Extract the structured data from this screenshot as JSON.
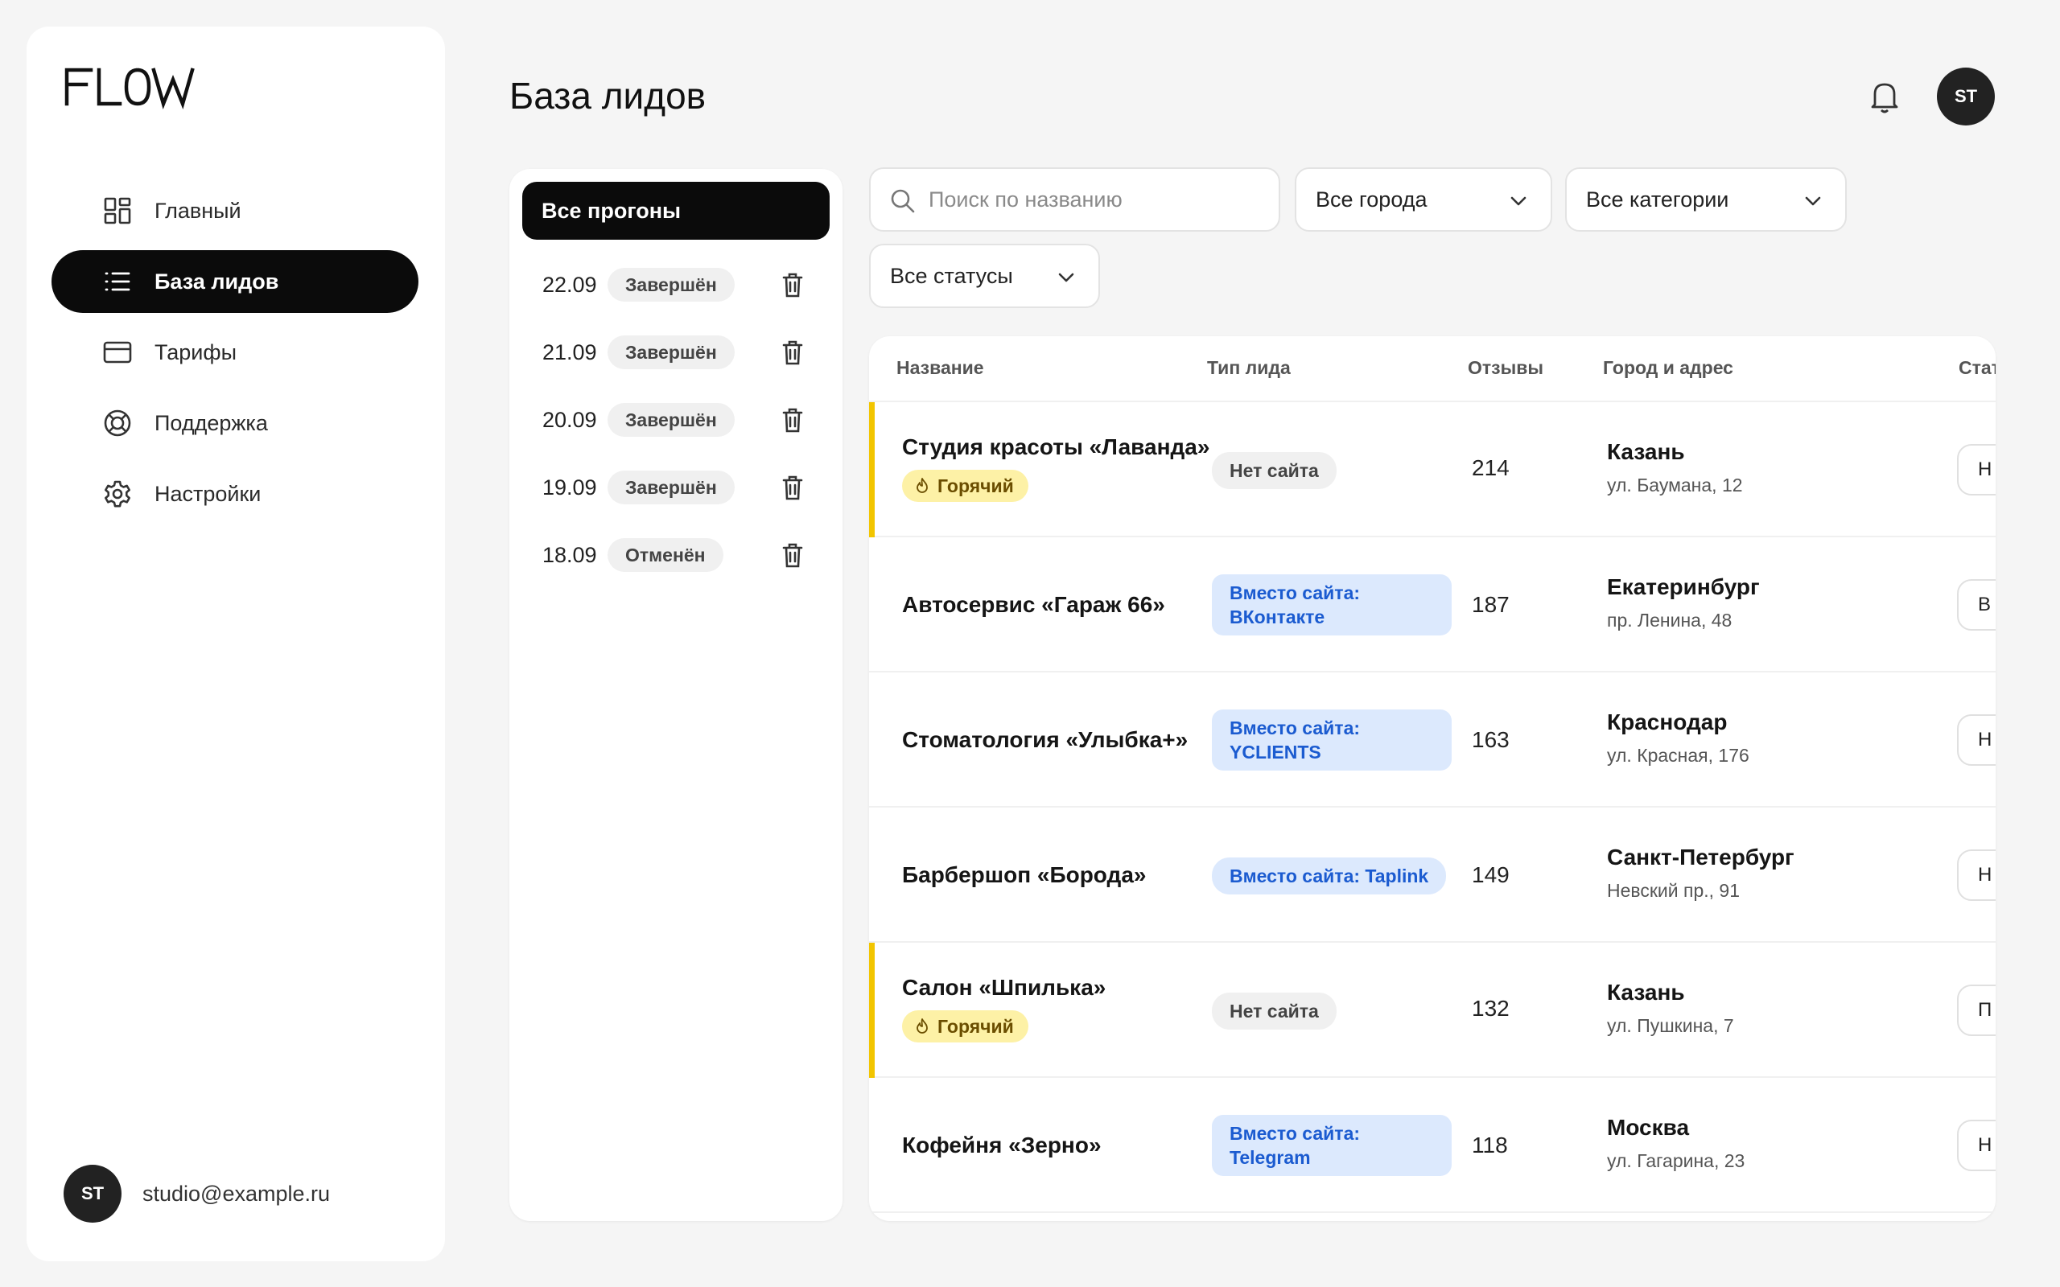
{
  "brand": {
    "logo_text": "FLOW"
  },
  "sidebar": {
    "items": [
      {
        "label": "Главный",
        "icon": "dashboard-grid-icon",
        "active": false
      },
      {
        "label": "База лидов",
        "icon": "list-icon",
        "active": true
      },
      {
        "label": "Тарифы",
        "icon": "credit-card-icon",
        "active": false
      },
      {
        "label": "Поддержка",
        "icon": "lifebuoy-icon",
        "active": false
      },
      {
        "label": "Настройки",
        "icon": "gear-icon",
        "active": false
      }
    ],
    "user": {
      "initials": "ST",
      "email": "studio@example.ru"
    }
  },
  "header": {
    "title": "База лидов",
    "avatar_initials": "ST",
    "bell_icon": "bell-icon"
  },
  "runs": {
    "all_label": "Все прогоны",
    "items": [
      {
        "date": "22.09",
        "status": "Завершён"
      },
      {
        "date": "21.09",
        "status": "Завершён"
      },
      {
        "date": "20.09",
        "status": "Завершён"
      },
      {
        "date": "19.09",
        "status": "Завершён"
      },
      {
        "date": "18.09",
        "status": "Отменён"
      }
    ]
  },
  "filters": {
    "search_placeholder": "Поиск по названию",
    "city": "Все города",
    "category": "Все категории",
    "status": "Все статусы"
  },
  "table": {
    "columns": [
      "Название",
      "Тип лида",
      "Отзывы",
      "Город и адрес",
      "Стат"
    ],
    "hot_label": "Горячий",
    "rows": [
      {
        "name": "Студия красоты «Лаванда»",
        "hot": true,
        "type": "Нет сайта",
        "type_kind": "nosite",
        "reviews": "214",
        "city": "Казань",
        "address": "ул. Баумана, 12",
        "status": "Н"
      },
      {
        "name": "Автосервис «Гараж 66»",
        "hot": false,
        "type": "Вместо сайта: ВКонтакте",
        "type_kind": "instead",
        "reviews": "187",
        "city": "Екатеринбург",
        "address": "пр. Ленина, 48",
        "status": "В"
      },
      {
        "name": "Стоматология «Улыбка+»",
        "hot": false,
        "type": "Вместо сайта: YCLIENTS",
        "type_kind": "instead",
        "reviews": "163",
        "city": "Краснодар",
        "address": "ул. Красная, 176",
        "status": "Н"
      },
      {
        "name": "Барбершоп «Борода»",
        "hot": false,
        "type": "Вместо сайта: Taplink",
        "type_kind": "instead",
        "reviews": "149",
        "city": "Санкт-Петербург",
        "address": "Невский пр., 91",
        "status": "Н"
      },
      {
        "name": "Салон «Шпилька»",
        "hot": true,
        "type": "Нет сайта",
        "type_kind": "nosite",
        "reviews": "132",
        "city": "Казань",
        "address": "ул. Пушкина, 7",
        "status": "П"
      },
      {
        "name": "Кофейня «Зерно»",
        "hot": false,
        "type": "Вместо сайта: Telegram",
        "type_kind": "instead",
        "reviews": "118",
        "city": "Москва",
        "address": "ул. Гагарина, 23",
        "status": "Н"
      }
    ]
  },
  "colors": {
    "accent_dark": "#0b0b0b",
    "hot": "#f2c500",
    "link_blue": "#1b5bd0",
    "badge_blue_bg": "#dce9fd"
  }
}
